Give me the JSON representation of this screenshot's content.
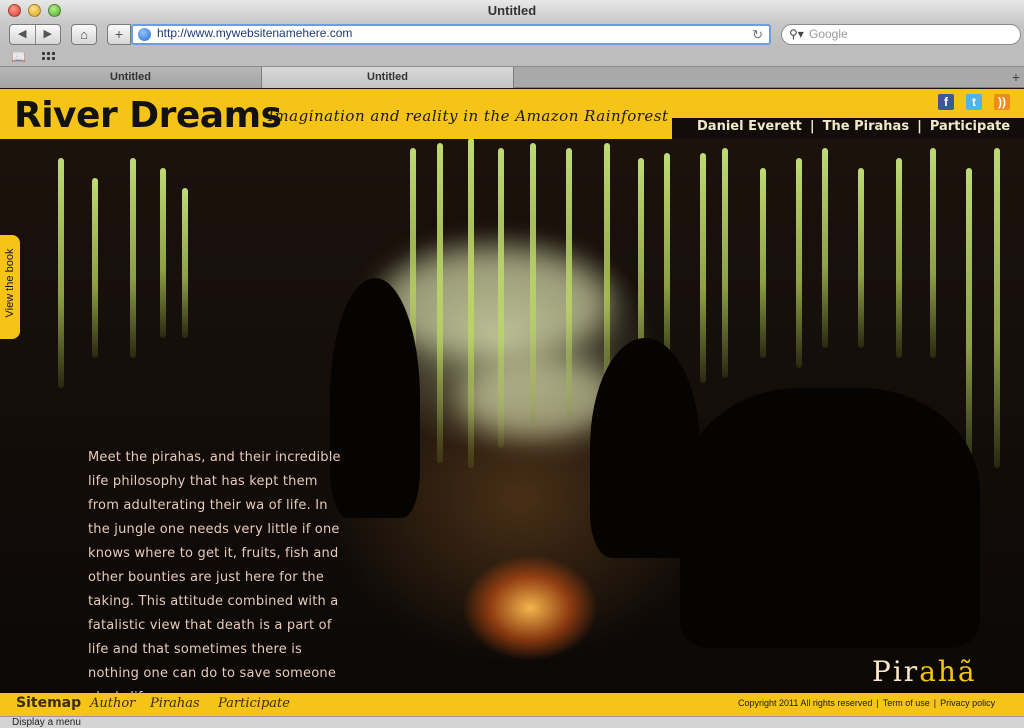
{
  "browser": {
    "window_title": "Untitled",
    "url": "http://www.mywebsitenamehere.com",
    "search_placeholder": "Google",
    "tabs": [
      {
        "label": "Untitled",
        "active": false
      },
      {
        "label": "Untitled",
        "active": true
      }
    ],
    "tab_add": "+",
    "status_text": "Display a menu"
  },
  "site": {
    "brand": "River Dreams",
    "tagline": "Imagination and reality in the Amazon Rainforest",
    "social": {
      "facebook": "f",
      "twitter": "t",
      "rss": "))"
    },
    "nav": {
      "daniel_everett": "Daniel Everett",
      "the_pirahas": "The Pirahas",
      "participate": "Participate",
      "separator": "|"
    },
    "view_book": "View the book",
    "intro_text": "Meet the pirahas, and their incredible life philosophy that has kept them from adulterating their wa of life. In the jungle one needs very little if one knows where to get it, fruits, fish and other bounties are just here for the taking. This attitude combined with a fatalistic view that death is a part of life and that sometimes there is nothing one can do to save someone else's life.",
    "logo": {
      "part1": "Pir",
      "part2": "aha",
      "part3": "̃"
    },
    "footer": {
      "sitemap": "Sitemap",
      "author": "Author",
      "pirahas": "Pirahas",
      "participate": "Participate",
      "copyright": "Copyright 2011 All rights reserved",
      "terms": "Term of use",
      "privacy": "Privacy policy",
      "separator": "|"
    }
  },
  "colors": {
    "accent_yellow": "#f6c416",
    "background_dark": "#120d0a",
    "intro_text": "#e8cbbb",
    "url_border": "#6b9de0"
  }
}
